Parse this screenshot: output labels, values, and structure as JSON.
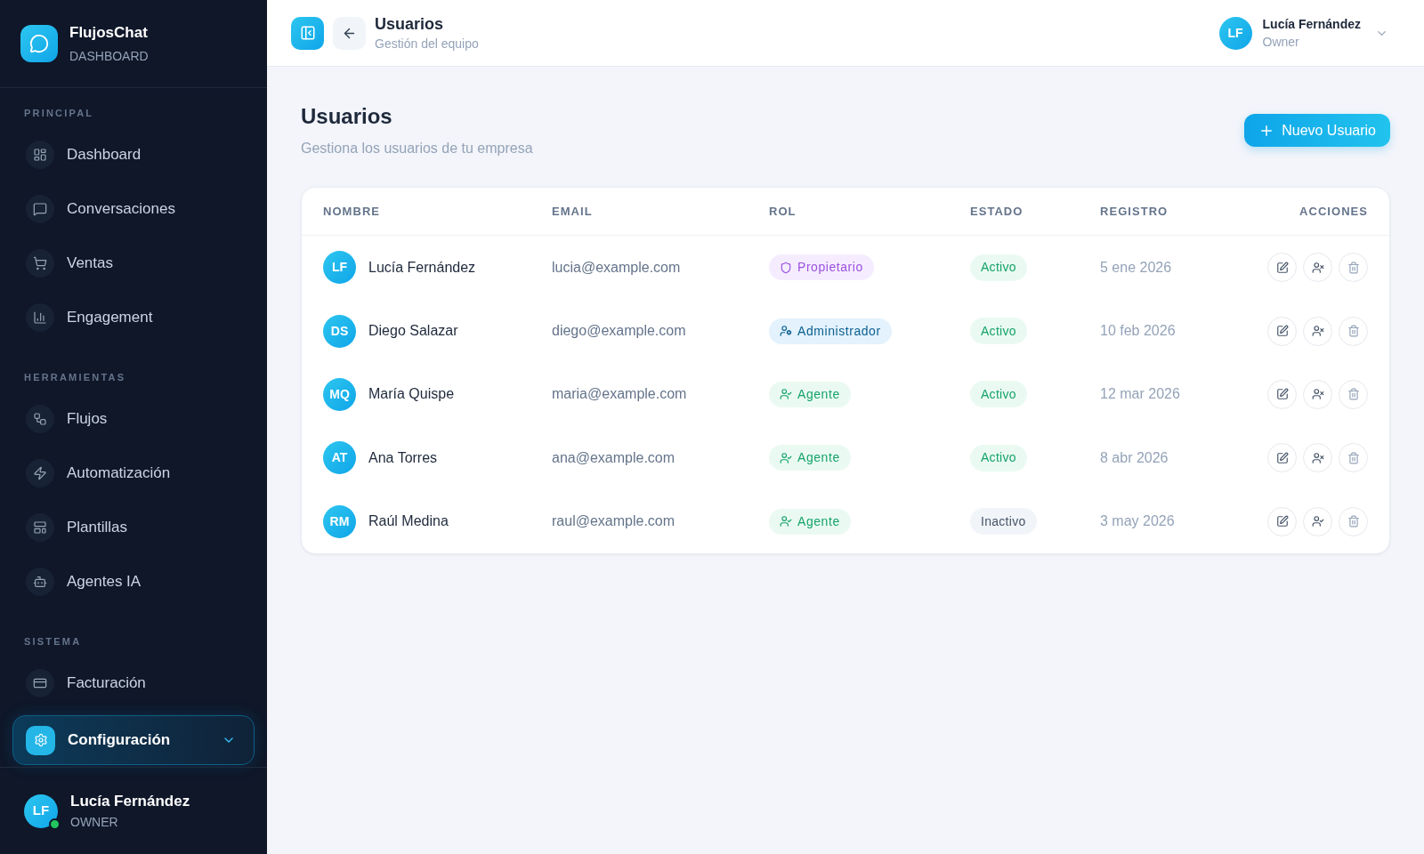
{
  "sidebar": {
    "brand": {
      "name": "FlujosChat",
      "subtitle": "DASHBOARD"
    },
    "sections": [
      {
        "title": "PRINCIPAL",
        "items": [
          {
            "label": "Dashboard",
            "selected": false,
            "submenu": false
          },
          {
            "label": "Conversaciones",
            "selected": false,
            "submenu": false
          },
          {
            "label": "Ventas",
            "selected": false,
            "submenu": false
          },
          {
            "label": "Engagement",
            "selected": false,
            "submenu": false
          }
        ]
      },
      {
        "title": "HERRAMIENTAS",
        "items": [
          {
            "label": "Flujos",
            "selected": false,
            "submenu": false
          },
          {
            "label": "Automatización",
            "selected": false,
            "submenu": false
          },
          {
            "label": "Plantillas",
            "selected": false,
            "submenu": false
          },
          {
            "label": "Agentes IA",
            "selected": false,
            "submenu": false
          }
        ]
      },
      {
        "title": "SISTEMA",
        "items": [
          {
            "label": "Facturación",
            "selected": false,
            "submenu": false
          },
          {
            "label": "Configuración",
            "selected": true,
            "submenu": true
          }
        ]
      }
    ],
    "user": {
      "initials": "LF",
      "name": "Lucía Fernández",
      "role": "OWNER",
      "online": true
    }
  },
  "header": {
    "title": "Usuarios",
    "subtitle": "Gestión del equipo",
    "user": {
      "initials": "LF",
      "name": "Lucía Fernández",
      "role": "Owner"
    }
  },
  "page": {
    "title": "Usuarios",
    "subtitle": "Gestiona los usuarios de tu empresa",
    "new_button": "Nuevo Usuario"
  },
  "table": {
    "columns": [
      "NOMBRE",
      "EMAIL",
      "ROL",
      "ESTADO",
      "REGISTRO",
      "ACCIONES"
    ],
    "rows": [
      {
        "initials": "LF",
        "name": "Lucía Fernández",
        "email": "lucia@example.com",
        "role": {
          "kind": "owner",
          "label": "Propietario"
        },
        "status": {
          "kind": "active",
          "label": "Activo"
        },
        "registered": "5 ene 2026"
      },
      {
        "initials": "DS",
        "name": "Diego Salazar",
        "email": "diego@example.com",
        "role": {
          "kind": "admin",
          "label": "Administrador"
        },
        "status": {
          "kind": "active",
          "label": "Activo"
        },
        "registered": "10 feb 2026"
      },
      {
        "initials": "MQ",
        "name": "María Quispe",
        "email": "maria@example.com",
        "role": {
          "kind": "agent",
          "label": "Agente"
        },
        "status": {
          "kind": "active",
          "label": "Activo"
        },
        "registered": "12 mar 2026"
      },
      {
        "initials": "AT",
        "name": "Ana Torres",
        "email": "ana@example.com",
        "role": {
          "kind": "agent",
          "label": "Agente"
        },
        "status": {
          "kind": "active",
          "label": "Activo"
        },
        "registered": "8 abr 2026"
      },
      {
        "initials": "RM",
        "name": "Raúl Medina",
        "email": "raul@example.com",
        "role": {
          "kind": "agent",
          "label": "Agente"
        },
        "status": {
          "kind": "inactive",
          "label": "Inactivo"
        },
        "registered": "3 may 2026"
      }
    ]
  }
}
